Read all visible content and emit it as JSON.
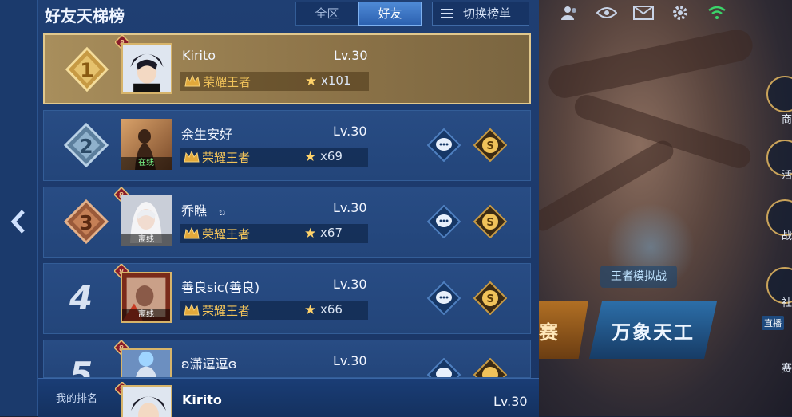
{
  "panel": {
    "title": "好友天梯榜",
    "tabs": [
      {
        "label": "全区",
        "active": false
      },
      {
        "label": "好友",
        "active": true
      }
    ],
    "switch_label": "切换榜单"
  },
  "rows": [
    {
      "rank": "1",
      "name": "Kirito",
      "level": "Lv.30",
      "tier": "荣耀王者",
      "stars": "x101",
      "status": ""
    },
    {
      "rank": "2",
      "name": "余生安好",
      "level": "Lv.30",
      "tier": "荣耀王者",
      "stars": "x69",
      "status": "在线"
    },
    {
      "rank": "3",
      "name": "乔瞧",
      "name_suffix": "ಬ",
      "level": "Lv.30",
      "tier": "荣耀王者",
      "stars": "x67",
      "status": "离线"
    },
    {
      "rank": "4",
      "name": "善良sic(善良)",
      "level": "Lv.30",
      "tier": "荣耀王者",
      "stars": "x66",
      "status": "离线"
    },
    {
      "rank": "5",
      "name": "ʚ潇逗逗ɞ",
      "level": "Lv.30"
    }
  ],
  "my_rank": {
    "label": "我的排名",
    "name": "Kirito",
    "level": "Lv.30"
  },
  "background": {
    "sim_label": "王者模拟战",
    "mode_label": "万象天工",
    "mode_left_label": "赛",
    "live_tag": "直播",
    "side_labels": [
      "商",
      "活",
      "战",
      "社",
      "赛"
    ]
  },
  "top_icons": [
    "friends-icon",
    "eye-icon",
    "mail-icon",
    "gear-icon",
    "wifi-icon"
  ],
  "colors": {
    "panel": "#1f3f73",
    "gold_row": "#a88e5c",
    "tier_text": "#f0c25a",
    "active_tab": "#4e8ad6"
  }
}
